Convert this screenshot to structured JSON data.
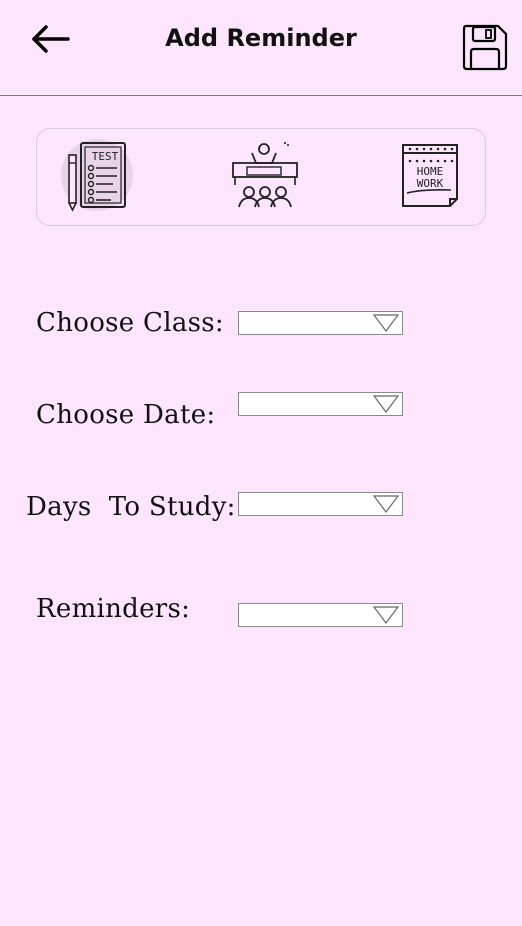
{
  "header": {
    "back_icon": "arrow-left-icon",
    "title": "Add Reminder",
    "save_icon": "floppy-disk-icon"
  },
  "reminder_types": [
    {
      "icon": "test-checklist-icon",
      "selected": true,
      "label_text": "TEST"
    },
    {
      "icon": "classroom-teacher-icon",
      "selected": false
    },
    {
      "icon": "homework-notepad-icon",
      "selected": false,
      "label_text": "HOME WORK"
    }
  ],
  "form": {
    "class_label": "Choose Class:",
    "date_label": "Choose Date:",
    "days_label": "Days  To Study:",
    "reminders_label": "Reminders:",
    "class_value": "",
    "date_value": "",
    "days_value": "",
    "reminders_value": "",
    "dropdown_icon": "triangle-down-icon"
  },
  "colors": {
    "background": "#fde6fd",
    "selected_highlight": "#e8d3e8",
    "divider": "#777777"
  }
}
